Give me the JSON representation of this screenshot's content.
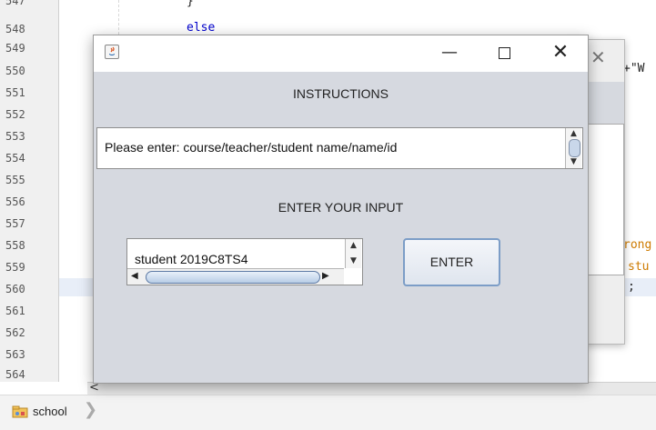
{
  "editor": {
    "line_numbers": [
      "547",
      "548",
      "549",
      "550",
      "551",
      "552",
      "553",
      "554",
      "555",
      "556",
      "557",
      "558",
      "559",
      "560",
      "561",
      "562",
      "563",
      "564"
    ],
    "code_brace": "}",
    "code_else": "else",
    "right_snippet_1": "+\"W",
    "right_snippet_2": "rong",
    "right_snippet_3": "stu",
    "right_snippet_4": ";"
  },
  "statusbar": {
    "scroll_left": "<",
    "project_label": "school",
    "project_icon": "project-folder-icon",
    "chevron": "❯"
  },
  "background_dialog": {
    "close_glyph": "✕"
  },
  "dialog": {
    "minimize_glyph": "—",
    "close_glyph": "✕",
    "instructions_title": "INSTRUCTIONS",
    "instructions_text": "Please enter: course/teacher/student name/name/id",
    "enter_title": "ENTER YOUR INPUT",
    "input_value": "student 2019C8TS4",
    "enter_button": "ENTER"
  },
  "colors": {
    "dialog_bg": "#d6d9e0",
    "button_border": "#7c9dc7",
    "scroll_thumb": "#b8cde6",
    "keyword_blue": "#0000cc",
    "string_orange": "#ce7b00"
  }
}
